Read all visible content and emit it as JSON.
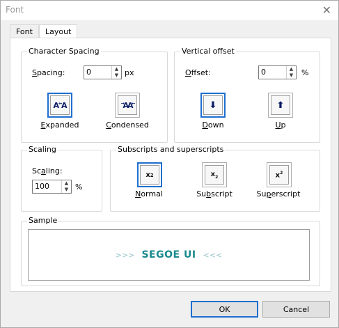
{
  "window": {
    "title": "Font",
    "close_glyph": "✕"
  },
  "tabs": [
    {
      "label": "Font"
    },
    {
      "label": "Layout"
    }
  ],
  "character_spacing": {
    "legend": "Character Spacing",
    "label": "Spacing:",
    "value": "0",
    "unit": "px",
    "expanded": "Expanded",
    "condensed": "Condensed",
    "expanded_icon_text": "A A",
    "condensed_icon_text": "AA"
  },
  "vertical_offset": {
    "legend": "Vertical offset",
    "label": "Offset:",
    "value": "0",
    "unit": "%",
    "down": "Down",
    "up": "Up"
  },
  "scaling": {
    "legend": "Scaling",
    "label": "Scaling:",
    "value": "100",
    "unit": "%"
  },
  "subs_supers": {
    "legend": "Subscripts and superscripts",
    "normal": "Normal",
    "subscript": "Subscript",
    "superscript": "Superscript",
    "normal_icon": "x",
    "normal_icon_exp": "2",
    "subscript_icon": "x",
    "subscript_icon_exp": "2",
    "superscript_icon": "x",
    "superscript_icon_exp": "2"
  },
  "sample": {
    "legend": "Sample",
    "left_marks": ">>>",
    "text": "SEGOE UI",
    "right_marks": "<<<"
  },
  "buttons": {
    "ok": "OK",
    "cancel": "Cancel"
  },
  "colors": {
    "accent": "#1e6fcf",
    "sample_text": "#1a8a8d",
    "sample_marks": "#98c6cc",
    "icon_dark": "#0a1a66"
  }
}
